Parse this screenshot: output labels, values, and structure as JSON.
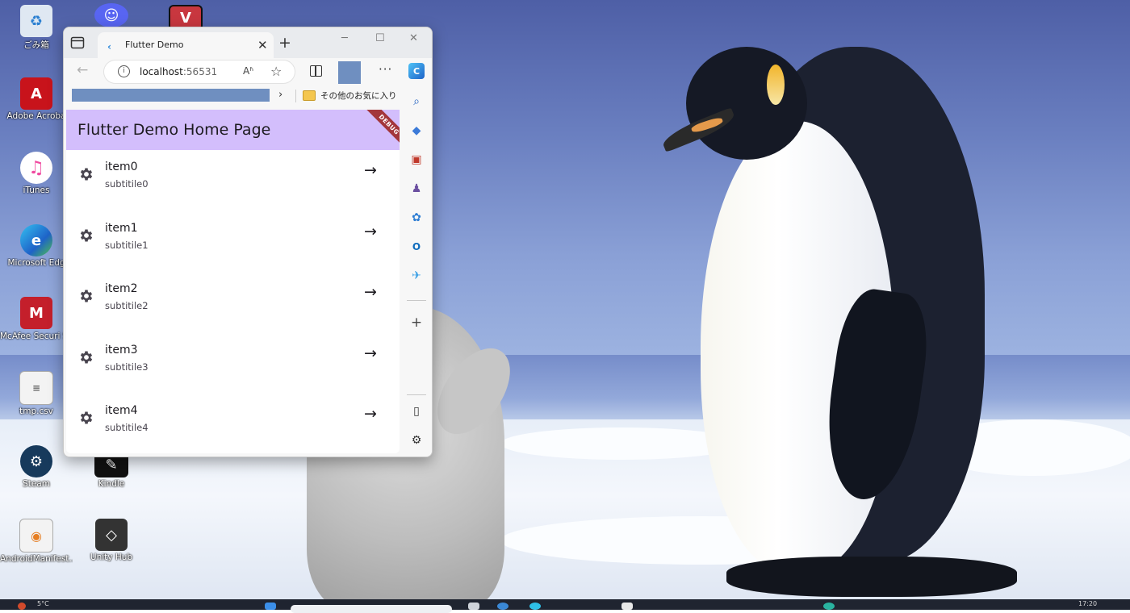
{
  "desktop": {
    "icons": [
      {
        "label": "ごみ箱",
        "icon": "recycle-bin-icon",
        "color": "#dfe8f2"
      },
      {
        "label": "Adobe Acroba",
        "icon": "adobe-acrobat-icon",
        "color": "#c8131b"
      },
      {
        "label": "iTunes",
        "icon": "itunes-icon",
        "color": "#f04aa0"
      },
      {
        "label": "Microsoft Edg",
        "icon": "edge-icon",
        "color": "#1e8de0"
      },
      {
        "label": "McAfee Securi Scan Plus",
        "icon": "mcafee-icon",
        "color": "#c41f2b"
      },
      {
        "label": "tmp.csv",
        "icon": "csv-file-icon",
        "color": "#f3f3f3"
      },
      {
        "label": "Steam",
        "icon": "steam-icon",
        "color": "#173a5c"
      },
      {
        "label": "Kindle",
        "icon": "kindle-icon",
        "color": "#111111"
      },
      {
        "label": "AndroidManifest...",
        "icon": "xml-file-icon",
        "color": "#f3f3f3"
      },
      {
        "label": "Unity Hub",
        "icon": "unity-hub-icon",
        "color": "#333333"
      },
      {
        "label": "",
        "icon": "discord-icon",
        "color": "#5865f2"
      },
      {
        "label": "",
        "icon": "valorant-icon",
        "color": "#c8373f"
      }
    ]
  },
  "browser": {
    "tab": {
      "title": "Flutter Demo",
      "close": "✕",
      "new": "+"
    },
    "window_controls": {
      "minimize": "─",
      "maximize": "☐",
      "close": "✕"
    },
    "address": {
      "host": "localhost",
      "port": ":56531",
      "read_aloud": "Aʱ"
    },
    "menu": "···",
    "favorites_label": "その他のお気に入り",
    "profile_color": "#6f8fc0"
  },
  "app": {
    "title": "Flutter Demo Home Page",
    "debug_banner": "DEBUG",
    "appbar_color": "#d3befc",
    "items": [
      {
        "title": "item0",
        "subtitle": "subtitile0"
      },
      {
        "title": "item1",
        "subtitle": "subtitile1"
      },
      {
        "title": "item2",
        "subtitle": "subtitile2"
      },
      {
        "title": "item3",
        "subtitle": "subtitile3"
      },
      {
        "title": "item4",
        "subtitle": "subtitile4"
      }
    ]
  },
  "taskbar": {
    "weather": "5°C",
    "time": "17:20"
  }
}
